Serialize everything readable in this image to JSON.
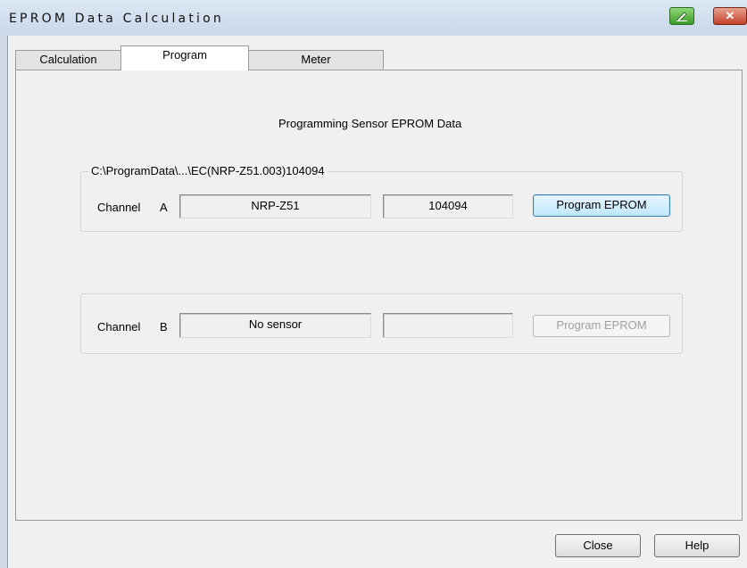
{
  "window": {
    "title": "EPROM Data Calculation",
    "close_glyph": "✕"
  },
  "tabs": [
    {
      "label": "Calculation"
    },
    {
      "label": "Program"
    },
    {
      "label": "Meter"
    }
  ],
  "panel": {
    "heading": "Programming Sensor EPROM Data",
    "channel_a": {
      "path": "C:\\ProgramData\\...\\EC(NRP-Z51.003)104094",
      "label": "Channel",
      "letter": "A",
      "sensor": "NRP-Z51",
      "serial": "104094",
      "button": "Program EPROM"
    },
    "channel_b": {
      "label": "Channel",
      "letter": "B",
      "sensor": "No sensor",
      "serial": "",
      "button": "Program EPROM"
    }
  },
  "footer": {
    "close": "Close",
    "help": "Help"
  },
  "colors": {
    "titlebar": "#c9d7e8",
    "focus_border": "#3c7fb1"
  }
}
